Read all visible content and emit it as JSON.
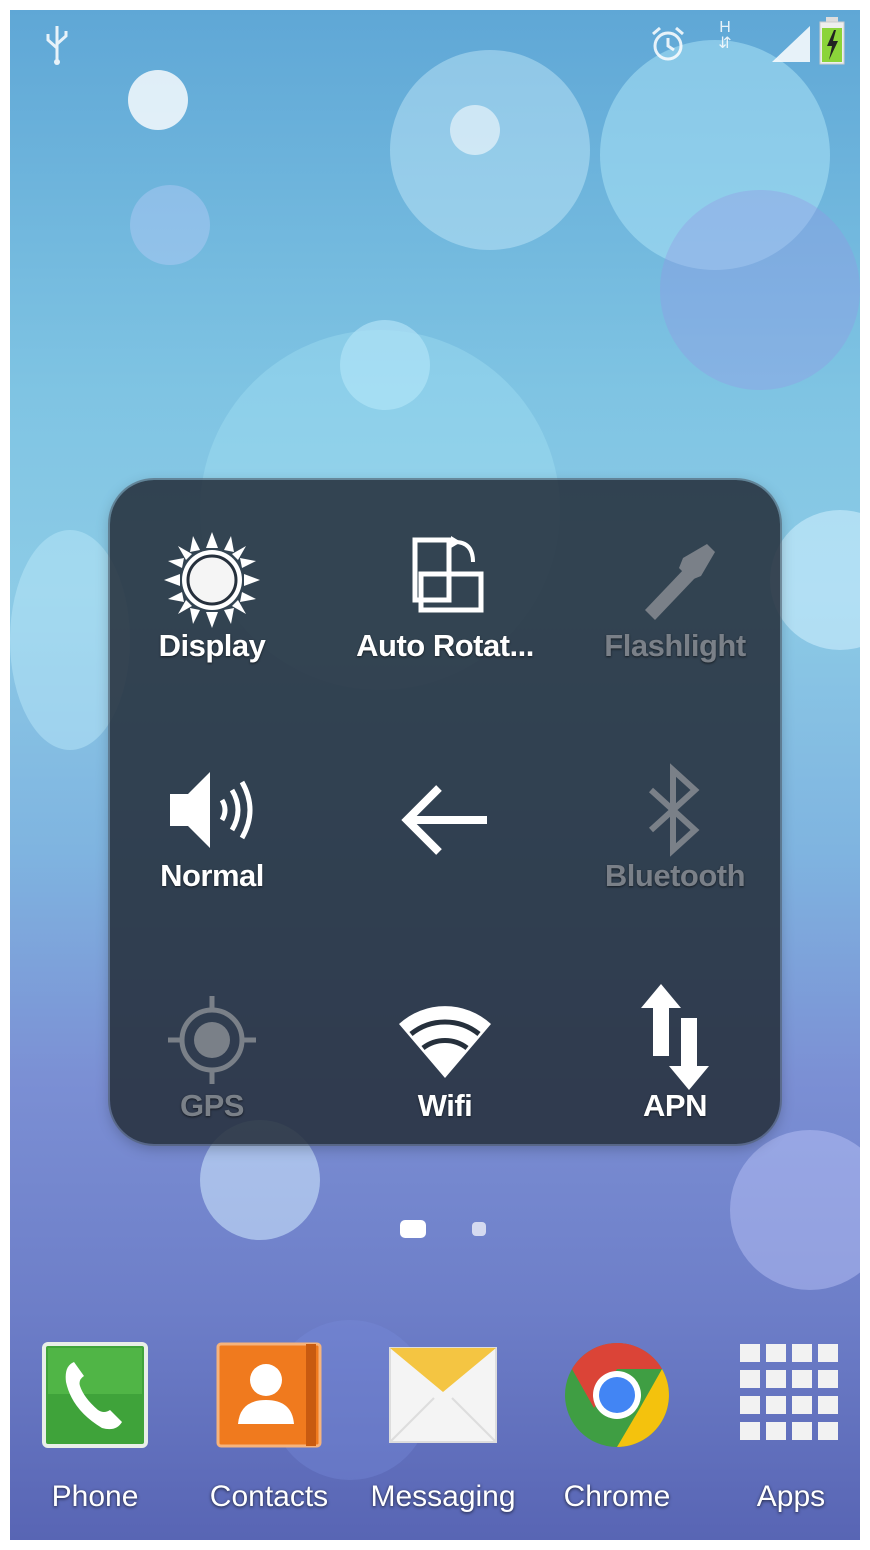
{
  "status_bar": {
    "icons": [
      "usb-icon",
      "alarm-icon",
      "hspa-data-icon",
      "signal-icon",
      "battery-charging-icon"
    ],
    "network_type": "H"
  },
  "quick_panel": {
    "tiles": [
      {
        "label": "Display",
        "icon": "sun-icon",
        "enabled": true
      },
      {
        "label": "Auto Rotat...",
        "icon": "auto-rotate-icon",
        "enabled": true
      },
      {
        "label": "Flashlight",
        "icon": "flashlight-icon",
        "enabled": false
      },
      {
        "label": "Normal",
        "icon": "speaker-icon",
        "enabled": true
      },
      {
        "label": "",
        "icon": "back-arrow-icon",
        "enabled": true
      },
      {
        "label": "Bluetooth",
        "icon": "bluetooth-icon",
        "enabled": false
      },
      {
        "label": "GPS",
        "icon": "gps-icon",
        "enabled": false
      },
      {
        "label": "Wifi",
        "icon": "wifi-icon",
        "enabled": true
      },
      {
        "label": "APN",
        "icon": "data-arrows-icon",
        "enabled": true
      }
    ]
  },
  "home": {
    "page_count": 2,
    "current_page": 1
  },
  "dock": {
    "items": [
      {
        "label": "Phone",
        "icon": "phone-icon"
      },
      {
        "label": "Contacts",
        "icon": "contacts-icon"
      },
      {
        "label": "Messaging",
        "icon": "messaging-icon"
      },
      {
        "label": "Chrome",
        "icon": "chrome-icon"
      },
      {
        "label": "Apps",
        "icon": "apps-grid-icon"
      }
    ]
  },
  "colors": {
    "panel_bg": "#26303c",
    "disabled_label": "#7a8088",
    "phone_green": "#3fa33a",
    "contacts_orange": "#f07a1e",
    "messaging_yellow": "#f4c542"
  }
}
